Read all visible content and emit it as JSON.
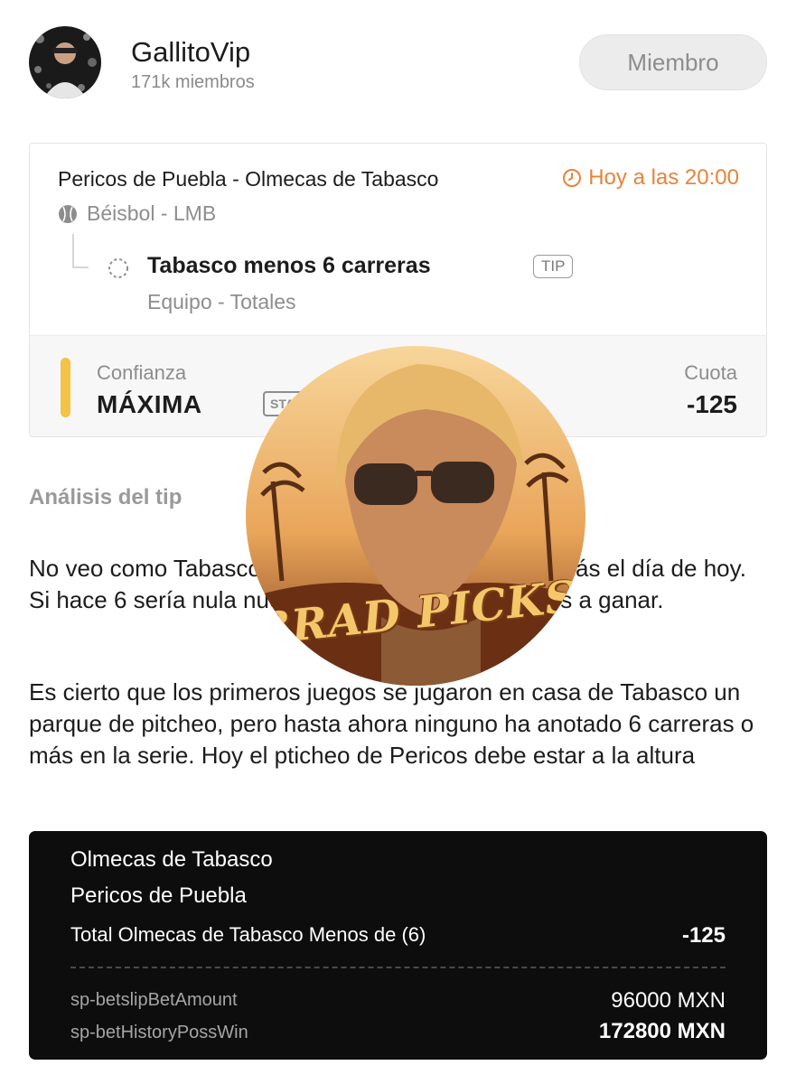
{
  "channel": {
    "name": "GallitoVip",
    "members": "171k miembros",
    "member_button": "Miembro"
  },
  "tip": {
    "match": "Pericos de Puebla  - Olmecas de Tabasco",
    "kickoff": "Hoy a las 20:00",
    "sport": "Béisbol - LMB",
    "pick": "Tabasco menos 6 carreras",
    "tag": "TIP",
    "market": "Equipo - Totales",
    "confidence_label": "Confianza",
    "confidence_value": "MÁXIMA",
    "stake": "STAKE 10",
    "odds_label": "Cuota",
    "odds_value": "-125"
  },
  "analysis": {
    "heading": "Análisis del tip",
    "paragraphs": [
      "No veo como Tabasco pueda fabricar 6 carreras o más el día de hoy. Si hace 6 sería nula nuestra apuesta, pero la vamos a ganar.",
      "Es cierto que los primeros juegos se jugaron en casa de Tabasco un parque de pitcheo, pero hasta ahora ninguno ha anotado 6 carreras o más en la serie. Hoy el pticheo de Pericos debe estar a la altura"
    ]
  },
  "watermark": {
    "text": "BRAD PICKS"
  },
  "betslip": {
    "team1": "Olmecas de Tabasco",
    "team2": "Pericos de Puebla",
    "selection": "Total Olmecas de Tabasco Menos de (6)",
    "odds": "-125",
    "amount_label": "sp-betslipBetAmount",
    "amount_value": "96000 MXN",
    "win_label": "sp-betHistoryPossWin",
    "win_value": "172800 MXN"
  },
  "colors": {
    "accent_orange": "#e8833a",
    "confidence_yellow": "#f5c248",
    "slip_background": "#0d0d0d"
  },
  "icons": [
    "avatar-image",
    "clock-icon",
    "baseball-icon",
    "pending-status-icon"
  ]
}
